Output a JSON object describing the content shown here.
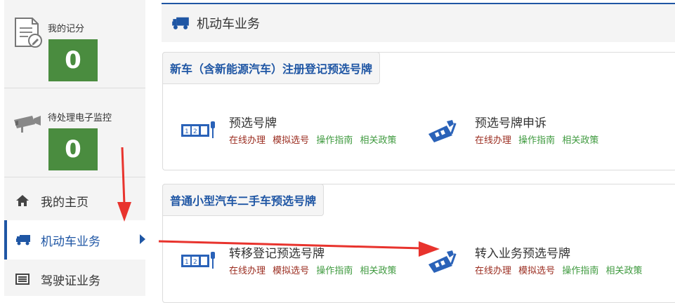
{
  "sidebar": {
    "score": {
      "label": "我的记分",
      "value": "0"
    },
    "monitor": {
      "label": "待处理电子监控",
      "value": "0"
    },
    "nav": [
      {
        "label": "我的主页",
        "icon": "home-icon"
      },
      {
        "label": "机动车业务",
        "icon": "truck-icon",
        "active": true
      },
      {
        "label": "驾驶证业务",
        "icon": "license-card-icon"
      }
    ]
  },
  "header": {
    "title": "机动车业务",
    "icon": "truck-icon"
  },
  "panels": [
    {
      "title": "新车（含新能源汽车）注册登记预选号牌",
      "services": [
        {
          "title": "预选号牌",
          "icon": "plate-icon",
          "links": [
            "在线办理",
            "模拟选号",
            "操作指南",
            "相关政策"
          ]
        },
        {
          "title": "预选号牌申诉",
          "icon": "plate-appeal-icon",
          "links": [
            "在线办理",
            "操作指南",
            "相关政策"
          ]
        }
      ]
    },
    {
      "title": "普通小型汽车二手车预选号牌",
      "services": [
        {
          "title": "转移登记预选号牌",
          "icon": "plate-icon",
          "links": [
            "在线办理",
            "模拟选号",
            "操作指南",
            "相关政策"
          ]
        },
        {
          "title": "转入业务预选号牌",
          "icon": "plate-appeal-icon",
          "links": [
            "在线办理",
            "模拟选号",
            "操作指南",
            "相关政策"
          ]
        }
      ]
    }
  ],
  "colors": {
    "accent": "#1f56a4",
    "stat_green": "#4a8c3f",
    "link_red": "#9b2d20",
    "link_green": "#3f9a3f",
    "annotation": "#e8332d"
  }
}
